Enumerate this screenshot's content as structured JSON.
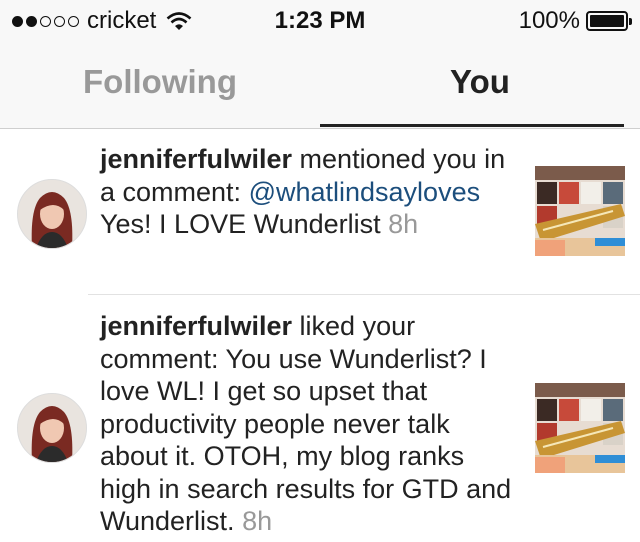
{
  "status_bar": {
    "carrier": "cricket",
    "time": "1:23 PM",
    "battery_percent": "100%",
    "battery_level": 1.0,
    "signal_bars_filled": 2,
    "signal_bars_total": 5
  },
  "tabs": [
    {
      "label": "Following",
      "active": false
    },
    {
      "label": "You",
      "active": true
    }
  ],
  "notifications": [
    {
      "username": "jenniferfulwiler",
      "action": " mentioned you in a comment: ",
      "mention": "@whatlindsayloves",
      "comment": " Yes! I LOVE Wunderlist ",
      "time": "8h"
    },
    {
      "username": "jenniferfulwiler",
      "action": " liked your comment: You use Wunderlist? I love WL! I get so upset that productivity people never talk about it. OTOH, my blog ranks high in search results for GTD and Wunderlist. ",
      "time": "8h"
    }
  ],
  "colors": {
    "mention_link": "#1c4e7c",
    "inactive_tab": "#999999",
    "timestamp": "#999999"
  }
}
